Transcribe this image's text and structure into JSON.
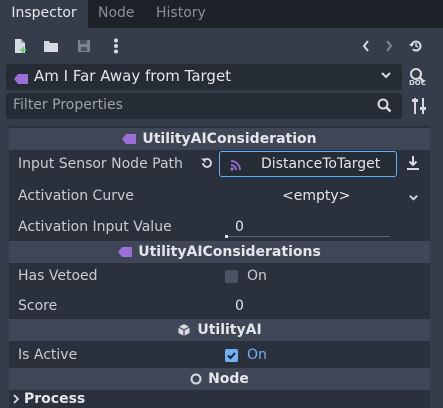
{
  "tabs": [
    {
      "label": "Inspector",
      "active": true
    },
    {
      "label": "Node",
      "active": false
    },
    {
      "label": "History",
      "active": false
    }
  ],
  "object": {
    "name": "Am I Far Away from Target",
    "doc_label": "DOC"
  },
  "filter": {
    "placeholder": "Filter Properties"
  },
  "sections": {
    "consideration": "UtilityAIConsideration",
    "considerations": "UtilityAIConsiderations",
    "utility_ai": "UtilityAI",
    "node": "Node",
    "process": "Process"
  },
  "properties": {
    "input_sensor": {
      "label": "Input Sensor Node Path",
      "value": "DistanceToTarget"
    },
    "activation_curve": {
      "label": "Activation Curve",
      "value": "<empty>"
    },
    "activation_input": {
      "label": "Activation Input Value",
      "value": "0"
    },
    "has_vetoed": {
      "label": "Has Vetoed",
      "checkbox_label": "On",
      "checked": false
    },
    "score": {
      "label": "Score",
      "value": "0"
    },
    "is_active": {
      "label": "Is Active",
      "checkbox_label": "On",
      "checked": true
    }
  },
  "colors": {
    "accent": "#6fb1f5",
    "focus_border": "#5fb2ff",
    "class_icon": "#9b6fd6",
    "section_bg": "#3f4757"
  }
}
